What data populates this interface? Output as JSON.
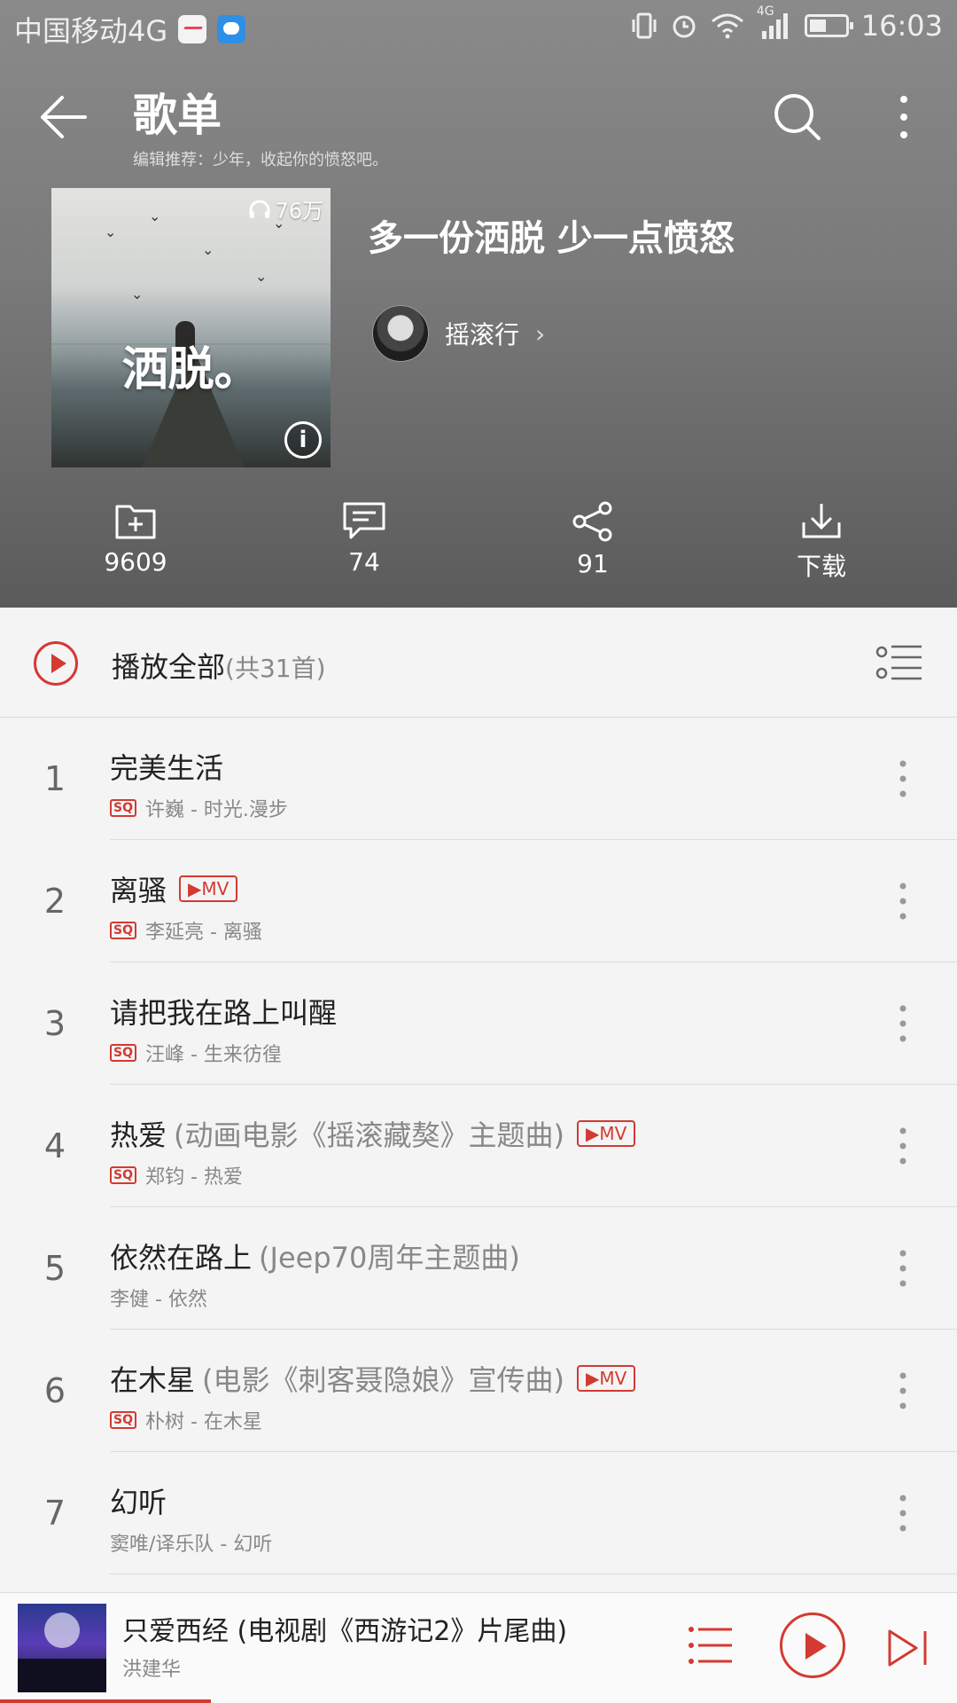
{
  "status_bar": {
    "carrier": "中国移动4G",
    "time": "16:03",
    "network_badge": "4G"
  },
  "header": {
    "title": "歌单",
    "subtitle": "编辑推荐：少年，收起你的愤怒吧。"
  },
  "playlist": {
    "cover_text": "洒脱。",
    "play_count": "76万",
    "name": "多一份洒脱 少一点愤怒",
    "creator": "摇滚行",
    "accent_color": "#d33a31"
  },
  "actions": [
    {
      "icon": "add-folder-icon",
      "label": "9609"
    },
    {
      "icon": "comment-icon",
      "label": "74"
    },
    {
      "icon": "share-icon",
      "label": "91"
    },
    {
      "icon": "download-icon",
      "label": "下载"
    }
  ],
  "play_all": {
    "label": "播放全部",
    "count": "(共31首)"
  },
  "songs": [
    {
      "index": "1",
      "title": "完美生活",
      "note": "",
      "mv": false,
      "sq": true,
      "sub": "许巍 - 时光.漫步"
    },
    {
      "index": "2",
      "title": "离骚",
      "note": "",
      "mv": true,
      "sq": true,
      "sub": "李延亮 - 离骚"
    },
    {
      "index": "3",
      "title": "请把我在路上叫醒",
      "note": "",
      "mv": false,
      "sq": true,
      "sub": "汪峰 - 生来彷徨"
    },
    {
      "index": "4",
      "title": "热爱",
      "note": "(动画电影《摇滚藏獒》主题曲)",
      "mv": true,
      "sq": true,
      "sub": "郑钧 - 热爱"
    },
    {
      "index": "5",
      "title": "依然在路上",
      "note": "(Jeep70周年主题曲)",
      "mv": false,
      "sq": false,
      "sub": "李健 - 依然"
    },
    {
      "index": "6",
      "title": "在木星",
      "note": "(电影《刺客聂隐娘》宣传曲)",
      "mv": true,
      "sq": true,
      "sub": "朴树 - 在木星"
    },
    {
      "index": "7",
      "title": "幻听",
      "note": "",
      "mv": false,
      "sq": false,
      "sub": "窦唯/译乐队 - 幻听"
    }
  ],
  "labels": {
    "mv": "▶MV",
    "sq": "SQ"
  },
  "player": {
    "title": "只爱西经 (电视剧《西游记2》片尾曲)",
    "artist": "洪建华",
    "progress": 0.22
  }
}
